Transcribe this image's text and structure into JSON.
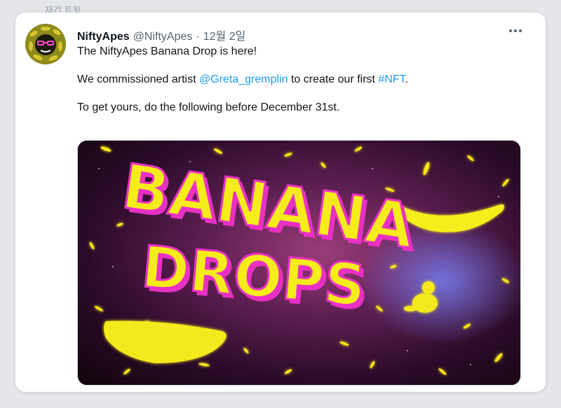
{
  "top_label": "재건 트윗",
  "tweet": {
    "author_name": "NiftyApes",
    "author_handle": "@NiftyApes",
    "separator": "·",
    "date": "12월 2일",
    "more_icon": "more-horizontal-icon",
    "line1": "The NiftyApes Banana Drop is here!",
    "line2_prefix": "We commissioned artist ",
    "line2_mention": "@Greta_gremplin",
    "line2_middle": " to create our first ",
    "line2_hashtag": "#NFT",
    "line2_suffix": ".",
    "line3": "To get yours, do the following before December 31st."
  },
  "media": {
    "title_word1": "BANANA",
    "title_word2": "DROPS"
  },
  "colors": {
    "link": "#1d9bf0",
    "banana": "#f5ec1c",
    "magenta": "#f03ad0"
  }
}
